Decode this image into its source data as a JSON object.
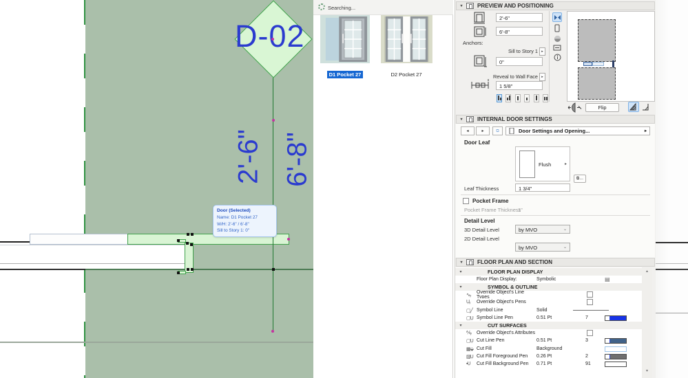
{
  "icons": {
    "triangle_down": "▾",
    "triangle_right": "▸",
    "triangle_left": "◂",
    "chevron_down": "⌄",
    "scroll_up": "▴",
    "scroll_down": "▾",
    "ellipsis": "…",
    "info": "i"
  },
  "colors": {
    "canvas_green": "#aabfaa",
    "highlight_green": "#d9f4d4",
    "selection_green": "#3fa04a",
    "cad_blue": "#2b3bcf",
    "hotspot_magenta": "#c433a0",
    "selected_label_blue": "#1667d2",
    "symbol_pen_7": "#1733e8",
    "cut_pen_3": "#41638a",
    "cut_fg_pen_2": "#6f6f6f",
    "cut_bg_pen_91": "#ffffff"
  },
  "canvas": {
    "diamond_label": "D-02",
    "dim_width": "2'-6\"",
    "dim_height": "6'-8\"",
    "tooltip": {
      "title": "Door (Selected)",
      "name_line": "Name: D1 Pocket 27",
      "wh_line": "W/H: 2'-6\" / 6'-8\"",
      "sill_line": "Sill to Story 1: 0\""
    }
  },
  "search": {
    "status": "Searching...",
    "items": [
      {
        "label": "D1 Pocket 27",
        "selected": true
      },
      {
        "label": "D2 Pocket 27",
        "selected": false
      }
    ]
  },
  "preview": {
    "title": "PREVIEW AND POSITIONING",
    "width_value": "2'-6\"",
    "height_value": "6'-8\"",
    "anchors_label": "Anchors:",
    "sill_anchor_label": "Sill to Story 1",
    "sill_value": "0\"",
    "reveal_anchor_label": "Reveal to Wall Face",
    "reveal_value": "1 5/8\"",
    "flip_label": "Flip"
  },
  "internal": {
    "title": "INTERNAL DOOR SETTINGS",
    "nav_label": "Door Settings and Opening...",
    "door_leaf_label": "Door Leaf",
    "leaf_style": "Flush",
    "leaf_thickness_label": "Leaf Thickness",
    "leaf_thickness_value": "1 3/4\"",
    "pocket_frame_label": "Pocket Frame",
    "pocket_frame_thickness_label": "Pocket Frame Thickness",
    "pocket_frame_thickness_value": "1\"",
    "detail_level_label": "Detail Level",
    "levels": [
      {
        "label": "3D Detail Level",
        "value": "by MVO"
      },
      {
        "label": "2D Detail Level",
        "value": "by MVO"
      }
    ]
  },
  "floorplan": {
    "title": "FLOOR PLAN AND SECTION",
    "groups": [
      {
        "title": "FLOOR PLAN DISPLAY"
      },
      {
        "title": "SYMBOL & OUTLINE"
      },
      {
        "title": "CUT SURFACES"
      }
    ],
    "rows": {
      "fpd": {
        "label": "Floor Plan Display:",
        "value": "Symbolic"
      },
      "olt": {
        "label": "Override Object's Line Types"
      },
      "oop": {
        "label": "Override Object's Pens"
      },
      "sl": {
        "label": "Symbol Line",
        "value": "Solid"
      },
      "slp": {
        "label": "Symbol Line Pen",
        "value": "0.51 Pt",
        "pen": "7"
      },
      "ooa": {
        "label": "Override Object's Attributes"
      },
      "clp": {
        "label": "Cut Line Pen",
        "value": "0.51 Pt",
        "pen": "3"
      },
      "cf": {
        "label": "Cut Fill",
        "value": "Background"
      },
      "cffp": {
        "label": "Cut Fill Foreground Pen",
        "value": "0.26 Pt",
        "pen": "2"
      },
      "cfbp": {
        "label": "Cut Fill Background Pen",
        "value": "0.71 Pt",
        "pen": "91"
      }
    }
  }
}
